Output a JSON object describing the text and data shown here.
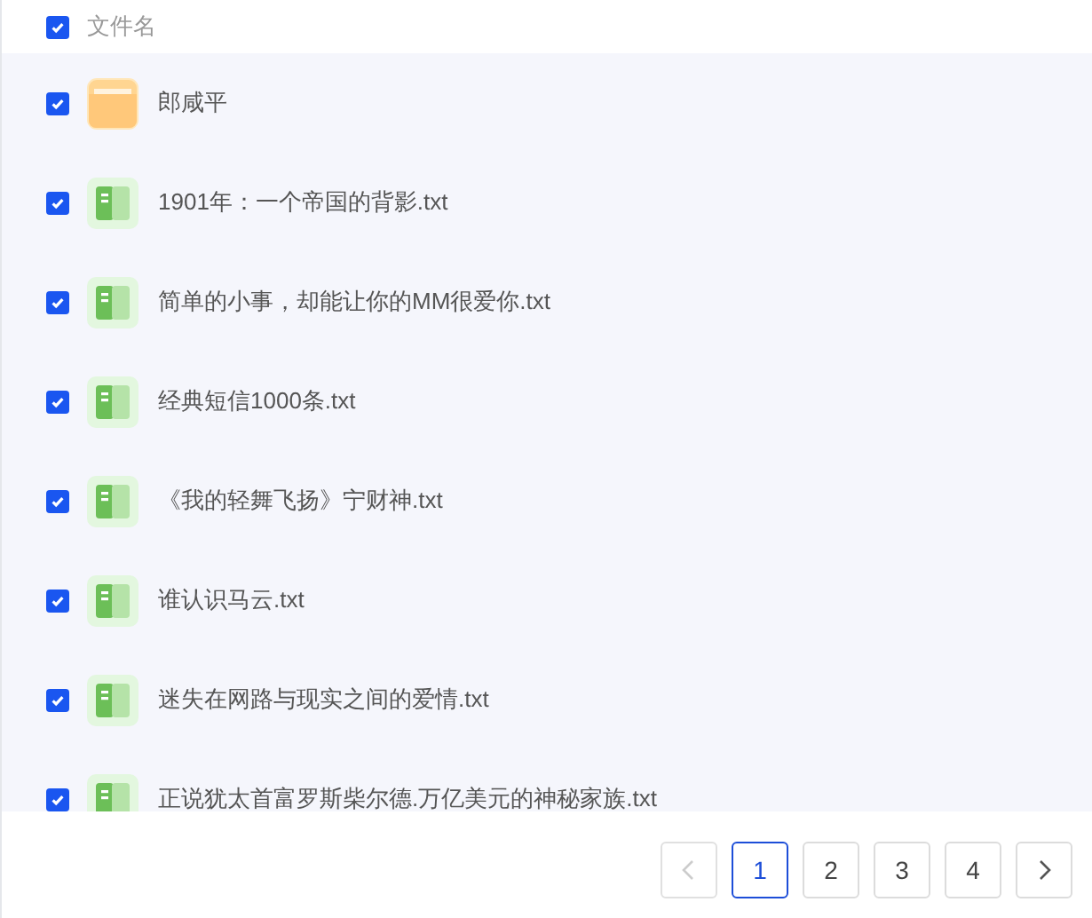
{
  "header": {
    "checked": true,
    "label": "文件名"
  },
  "files": [
    {
      "kind": "folder",
      "name": "郎咸平",
      "checked": true
    },
    {
      "kind": "txt",
      "name": "1901年：一个帝国的背影.txt",
      "checked": true
    },
    {
      "kind": "txt",
      "name": "简单的小事，却能让你的MM很爱你.txt",
      "checked": true
    },
    {
      "kind": "txt",
      "name": "经典短信1000条.txt",
      "checked": true
    },
    {
      "kind": "txt",
      "name": "《我的轻舞飞扬》宁财神.txt",
      "checked": true
    },
    {
      "kind": "txt",
      "name": "谁认识马云.txt",
      "checked": true
    },
    {
      "kind": "txt",
      "name": "迷失在网路与现实之间的爱情.txt",
      "checked": true
    },
    {
      "kind": "txt",
      "name": "正说犹太首富罗斯柴尔德.万亿美元的神秘家族.txt",
      "checked": true
    }
  ],
  "pagination": {
    "prev_disabled": true,
    "next_disabled": false,
    "pages": [
      {
        "label": "1",
        "selected": true
      },
      {
        "label": "2",
        "selected": false
      },
      {
        "label": "3",
        "selected": false
      },
      {
        "label": "4",
        "selected": false
      }
    ]
  }
}
